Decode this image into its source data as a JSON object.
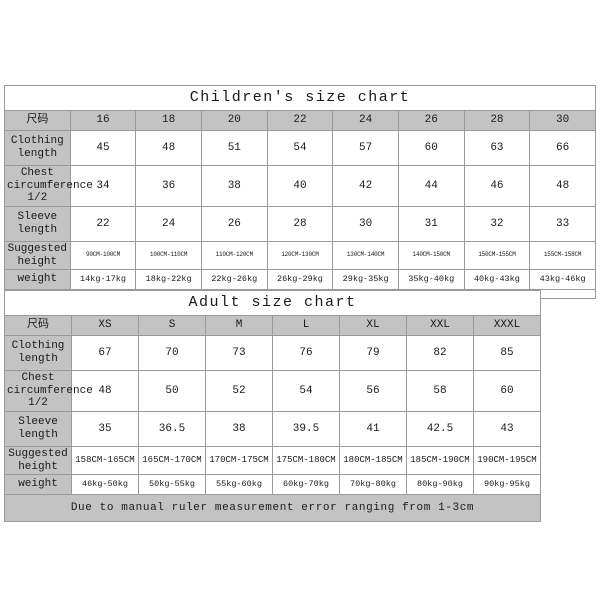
{
  "children_chart": {
    "title": "Children's size chart",
    "size_header_label": "尺码",
    "sizes": [
      "16",
      "18",
      "20",
      "22",
      "24",
      "26",
      "28",
      "30"
    ],
    "rows": [
      {
        "label": "Clothing length",
        "values": [
          "45",
          "48",
          "51",
          "54",
          "57",
          "60",
          "63",
          "66"
        ]
      },
      {
        "label": "Chest circumference 1/2",
        "values": [
          "34",
          "36",
          "38",
          "40",
          "42",
          "44",
          "46",
          "48"
        ]
      },
      {
        "label": "Sleeve length",
        "values": [
          "22",
          "24",
          "26",
          "28",
          "30",
          "31",
          "32",
          "33"
        ]
      },
      {
        "label": "Suggested height",
        "values": [
          "90CM-100CM",
          "100CM-110CM",
          "110CM-120CM",
          "120CM-130CM",
          "130CM-140CM",
          "140CM-150CM",
          "150CM-155CM",
          "155CM-158CM"
        ]
      },
      {
        "label": "weight",
        "values": [
          "14kg-17kg",
          "18kg-22kg",
          "22kg-26kg",
          "26kg-29kg",
          "29kg-35kg",
          "35kg-40kg",
          "40kg-43kg",
          "43kg-46kg"
        ]
      }
    ]
  },
  "adult_chart": {
    "title": "Adult size chart",
    "size_header_label": "尺码",
    "sizes": [
      "XS",
      "S",
      "M",
      "L",
      "XL",
      "XXL",
      "XXXL"
    ],
    "rows": [
      {
        "label": "Clothing length",
        "values": [
          "67",
          "70",
          "73",
          "76",
          "79",
          "82",
          "85"
        ]
      },
      {
        "label": "Chest circumference 1/2",
        "values": [
          "48",
          "50",
          "52",
          "54",
          "56",
          "58",
          "60"
        ]
      },
      {
        "label": "Sleeve length",
        "values": [
          "35",
          "36.5",
          "38",
          "39.5",
          "41",
          "42.5",
          "43"
        ]
      },
      {
        "label": "Suggested height",
        "values": [
          "158CM-165CM",
          "165CM-170CM",
          "170CM-175CM",
          "175CM-180CM",
          "180CM-185CM",
          "185CM-190CM",
          "190CM-195CM"
        ]
      },
      {
        "label": "weight",
        "values": [
          "46kg-50kg",
          "50kg-55kg",
          "55kg-60kg",
          "60kg-70kg",
          "70kg-80kg",
          "80kg-90kg",
          "90kg-95kg"
        ]
      }
    ],
    "footnote": "Due to manual ruler measurement error ranging from 1-3cm"
  },
  "colors": {
    "header_gray": "#c3c3c3",
    "border_gray": "#9a9a9a",
    "text": "#1a1a1a",
    "background": "#ffffff"
  }
}
